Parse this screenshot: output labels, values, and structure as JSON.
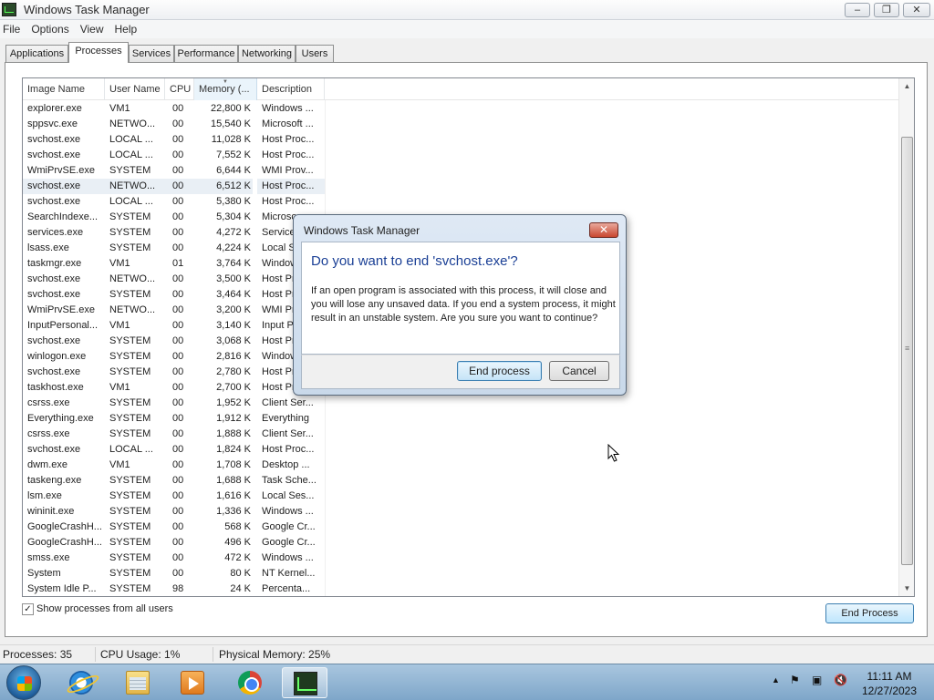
{
  "window": {
    "title": "Windows Task Manager"
  },
  "menu": [
    "File",
    "Options",
    "View",
    "Help"
  ],
  "tabs": [
    "Applications",
    "Processes",
    "Services",
    "Performance",
    "Networking",
    "Users"
  ],
  "active_tab": "Processes",
  "columns": [
    "Image Name",
    "User Name",
    "CPU",
    "Memory (...",
    "Description"
  ],
  "processes": [
    [
      "explorer.exe",
      "VM1",
      "00",
      "22,800 K",
      "Windows ..."
    ],
    [
      "sppsvc.exe",
      "NETWO...",
      "00",
      "15,540 K",
      "Microsoft ..."
    ],
    [
      "svchost.exe",
      "LOCAL ...",
      "00",
      "11,028 K",
      "Host Proc..."
    ],
    [
      "svchost.exe",
      "LOCAL ...",
      "00",
      "7,552 K",
      "Host Proc..."
    ],
    [
      "WmiPrvSE.exe",
      "SYSTEM",
      "00",
      "6,644 K",
      "WMI Prov..."
    ],
    [
      "svchost.exe",
      "NETWO...",
      "00",
      "6,512 K",
      "Host Proc..."
    ],
    [
      "svchost.exe",
      "LOCAL ...",
      "00",
      "5,380 K",
      "Host Proc..."
    ],
    [
      "SearchIndexe...",
      "SYSTEM",
      "00",
      "5,304 K",
      "Microso"
    ],
    [
      "services.exe",
      "SYSTEM",
      "00",
      "4,272 K",
      "Service"
    ],
    [
      "lsass.exe",
      "SYSTEM",
      "00",
      "4,224 K",
      "Local S"
    ],
    [
      "taskmgr.exe",
      "VM1",
      "01",
      "3,764 K",
      "Window"
    ],
    [
      "svchost.exe",
      "NETWO...",
      "00",
      "3,500 K",
      "Host Pr"
    ],
    [
      "svchost.exe",
      "SYSTEM",
      "00",
      "3,464 K",
      "Host Pr"
    ],
    [
      "WmiPrvSE.exe",
      "NETWO...",
      "00",
      "3,200 K",
      "WMI Pr"
    ],
    [
      "InputPersonal...",
      "VM1",
      "00",
      "3,140 K",
      "Input P"
    ],
    [
      "svchost.exe",
      "SYSTEM",
      "00",
      "3,068 K",
      "Host Pr"
    ],
    [
      "winlogon.exe",
      "SYSTEM",
      "00",
      "2,816 K",
      "Window"
    ],
    [
      "svchost.exe",
      "SYSTEM",
      "00",
      "2,780 K",
      "Host Pr"
    ],
    [
      "taskhost.exe",
      "VM1",
      "00",
      "2,700 K",
      "Host Pr"
    ],
    [
      "csrss.exe",
      "SYSTEM",
      "00",
      "1,952 K",
      "Client Ser..."
    ],
    [
      "Everything.exe",
      "SYSTEM",
      "00",
      "1,912 K",
      "Everything"
    ],
    [
      "csrss.exe",
      "SYSTEM",
      "00",
      "1,888 K",
      "Client Ser..."
    ],
    [
      "svchost.exe",
      "LOCAL ...",
      "00",
      "1,824 K",
      "Host Proc..."
    ],
    [
      "dwm.exe",
      "VM1",
      "00",
      "1,708 K",
      "Desktop ..."
    ],
    [
      "taskeng.exe",
      "SYSTEM",
      "00",
      "1,688 K",
      "Task Sche..."
    ],
    [
      "lsm.exe",
      "SYSTEM",
      "00",
      "1,616 K",
      "Local Ses..."
    ],
    [
      "wininit.exe",
      "SYSTEM",
      "00",
      "1,336 K",
      "Windows ..."
    ],
    [
      "GoogleCrashH...",
      "SYSTEM",
      "00",
      "568 K",
      "Google Cr..."
    ],
    [
      "GoogleCrashH...",
      "SYSTEM",
      "00",
      "496 K",
      "Google Cr..."
    ],
    [
      "smss.exe",
      "SYSTEM",
      "00",
      "472 K",
      "Windows ..."
    ],
    [
      "System",
      "SYSTEM",
      "00",
      "80 K",
      "NT Kernel..."
    ],
    [
      "System Idle P...",
      "SYSTEM",
      "98",
      "24 K",
      "Percenta..."
    ]
  ],
  "selected_row": 5,
  "show_all_users": {
    "label": "Show processes from all users",
    "checked": true
  },
  "end_process_button": "End Process",
  "status": {
    "processes": "Processes: 35",
    "cpu": "CPU Usage: 1%",
    "memory": "Physical Memory: 25%"
  },
  "dialog": {
    "title": "Windows Task Manager",
    "heading": "Do you want to end 'svchost.exe'?",
    "message": "If an open program is associated with this process, it will close and you will lose any unsaved data. If you end a system process, it might result in an unstable system. Are you sure you want to continue?",
    "ok_label": "End process",
    "cancel_label": "Cancel"
  },
  "taskbar": {
    "pinned": [
      "start-orb",
      "internet-explorer-icon",
      "windows-explorer-icon",
      "media-player-icon",
      "chrome-icon",
      "task-manager-icon"
    ],
    "clock_time": "11:11 AM",
    "clock_date": "12/27/2023"
  },
  "colors": {
    "dialog_heading": "#1a3f95",
    "selection": "#e9eff5",
    "taskbar": "#8fb3d4"
  }
}
